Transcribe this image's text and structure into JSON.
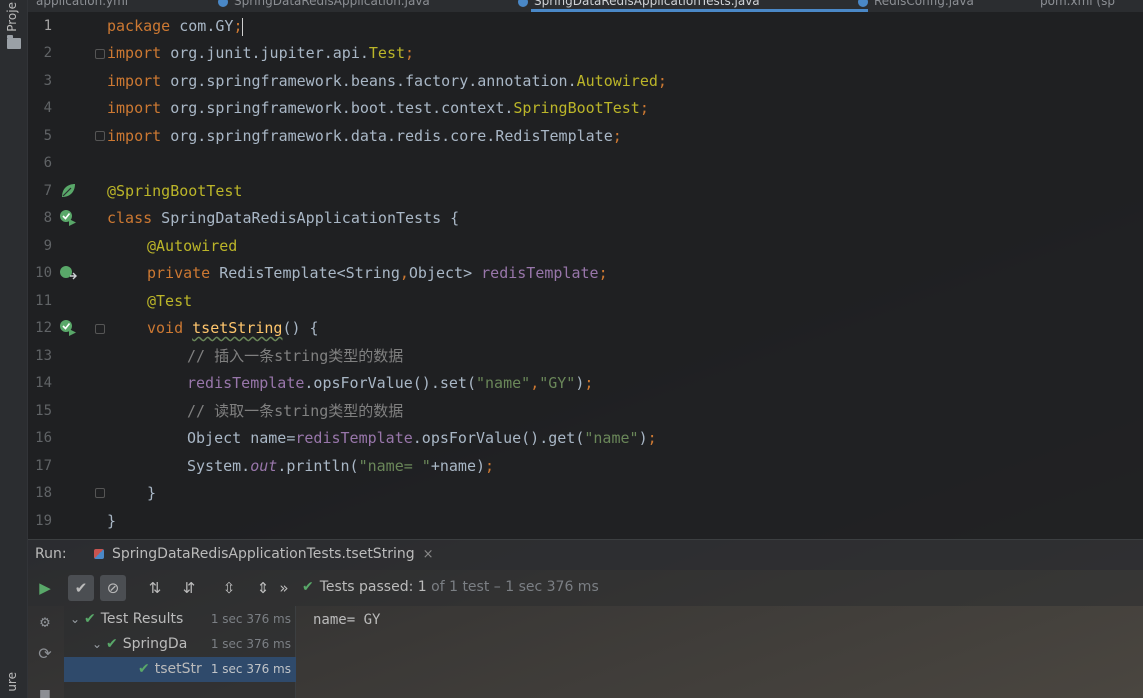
{
  "sidebar": {
    "project_label": "Proje",
    "structure_label": "ure"
  },
  "tabs": [
    {
      "label": "application.yml",
      "active": false
    },
    {
      "label": "SpringDataRedisApplication.java",
      "active": false
    },
    {
      "label": "SpringDataRedisApplicationTests.java",
      "active": true
    },
    {
      "label": "RedisConfig.java",
      "active": false
    },
    {
      "label": "pom.xml (sp",
      "active": false
    }
  ],
  "editor": {
    "line_numbers": [
      "1",
      "2",
      "3",
      "4",
      "5",
      "6",
      "7",
      "8",
      "9",
      "10",
      "11",
      "12",
      "13",
      "14",
      "15",
      "16",
      "17",
      "18",
      "19"
    ],
    "lines": {
      "l1_kw": "package",
      "l1_pkg": " com.GY",
      "l1_semi": ";",
      "l2_kw": "import",
      "l2_pkg": " org.junit.jupiter.api.",
      "l2_cls": "Test",
      "l2_semi": ";",
      "l3_kw": "import",
      "l3_pkg": " org.springframework.beans.factory.annotation.",
      "l3_cls": "Autowired",
      "l3_semi": ";",
      "l4_kw": "import",
      "l4_pkg": " org.springframework.boot.test.context.",
      "l4_cls": "SpringBootTest",
      "l4_semi": ";",
      "l5_kw": "import",
      "l5_pkg": " org.springframework.data.redis.core.RedisTemplate",
      "l5_semi": ";",
      "l7_ann": "@SpringBootTest",
      "l8_kw": "class",
      "l8_rest": " SpringDataRedisApplicationTests {",
      "l9_ann": "@Autowired",
      "l10_kw": "private",
      "l10_type": " RedisTemplate<String",
      "l10_comma": ",",
      "l10_type2": "Object> ",
      "l10_field": "redisTemplate",
      "l10_semi": ";",
      "l11_ann": "@Test",
      "l12_kw": "void",
      "l12_sp": " ",
      "l12_method": "tsetString",
      "l12_rest": "() {",
      "l13_cmt": "// 插入一条string类型的数据",
      "l14_field": "redisTemplate",
      "l14_mid": ".opsForValue().set(",
      "l14_s1": "\"name\"",
      "l14_comma": ",",
      "l14_s2": "\"GY\"",
      "l14_end": ")",
      "l14_semi": ";",
      "l15_cmt": "// 读取一条string类型的数据",
      "l16_a": "Object name=",
      "l16_field": "redisTemplate",
      "l16_mid": ".opsForValue().get(",
      "l16_s1": "\"name\"",
      "l16_end": ")",
      "l16_semi": ";",
      "l17_a": "System.",
      "l17_static": "out",
      "l17_b": ".println(",
      "l17_s1": "\"name= \"",
      "l17_c": "+name)",
      "l17_semi": ";",
      "l18": "}",
      "l19": "}"
    }
  },
  "run": {
    "label": "Run:",
    "tab_title": "SpringDataRedisApplicationTests.tsetString",
    "close": "×",
    "status_bold": "Tests passed: 1",
    "status_dim": " of 1 test – 1 sec 376 ms",
    "more": "»"
  },
  "tree": {
    "rows": [
      {
        "label": "Test Results",
        "time": "1 sec 376 ms"
      },
      {
        "label": "SpringDa",
        "time": "1 sec 376 ms"
      },
      {
        "label": "tsetStr",
        "time": "1 sec 376 ms"
      }
    ]
  },
  "console": {
    "output": "name= GY"
  },
  "colors": {
    "keyword": "#cc7832",
    "annotation": "#bbb529",
    "string": "#6a8759",
    "field": "#9876aa",
    "comment": "#808080",
    "pass_green": "#59a869",
    "selection": "#2f4a6b"
  }
}
